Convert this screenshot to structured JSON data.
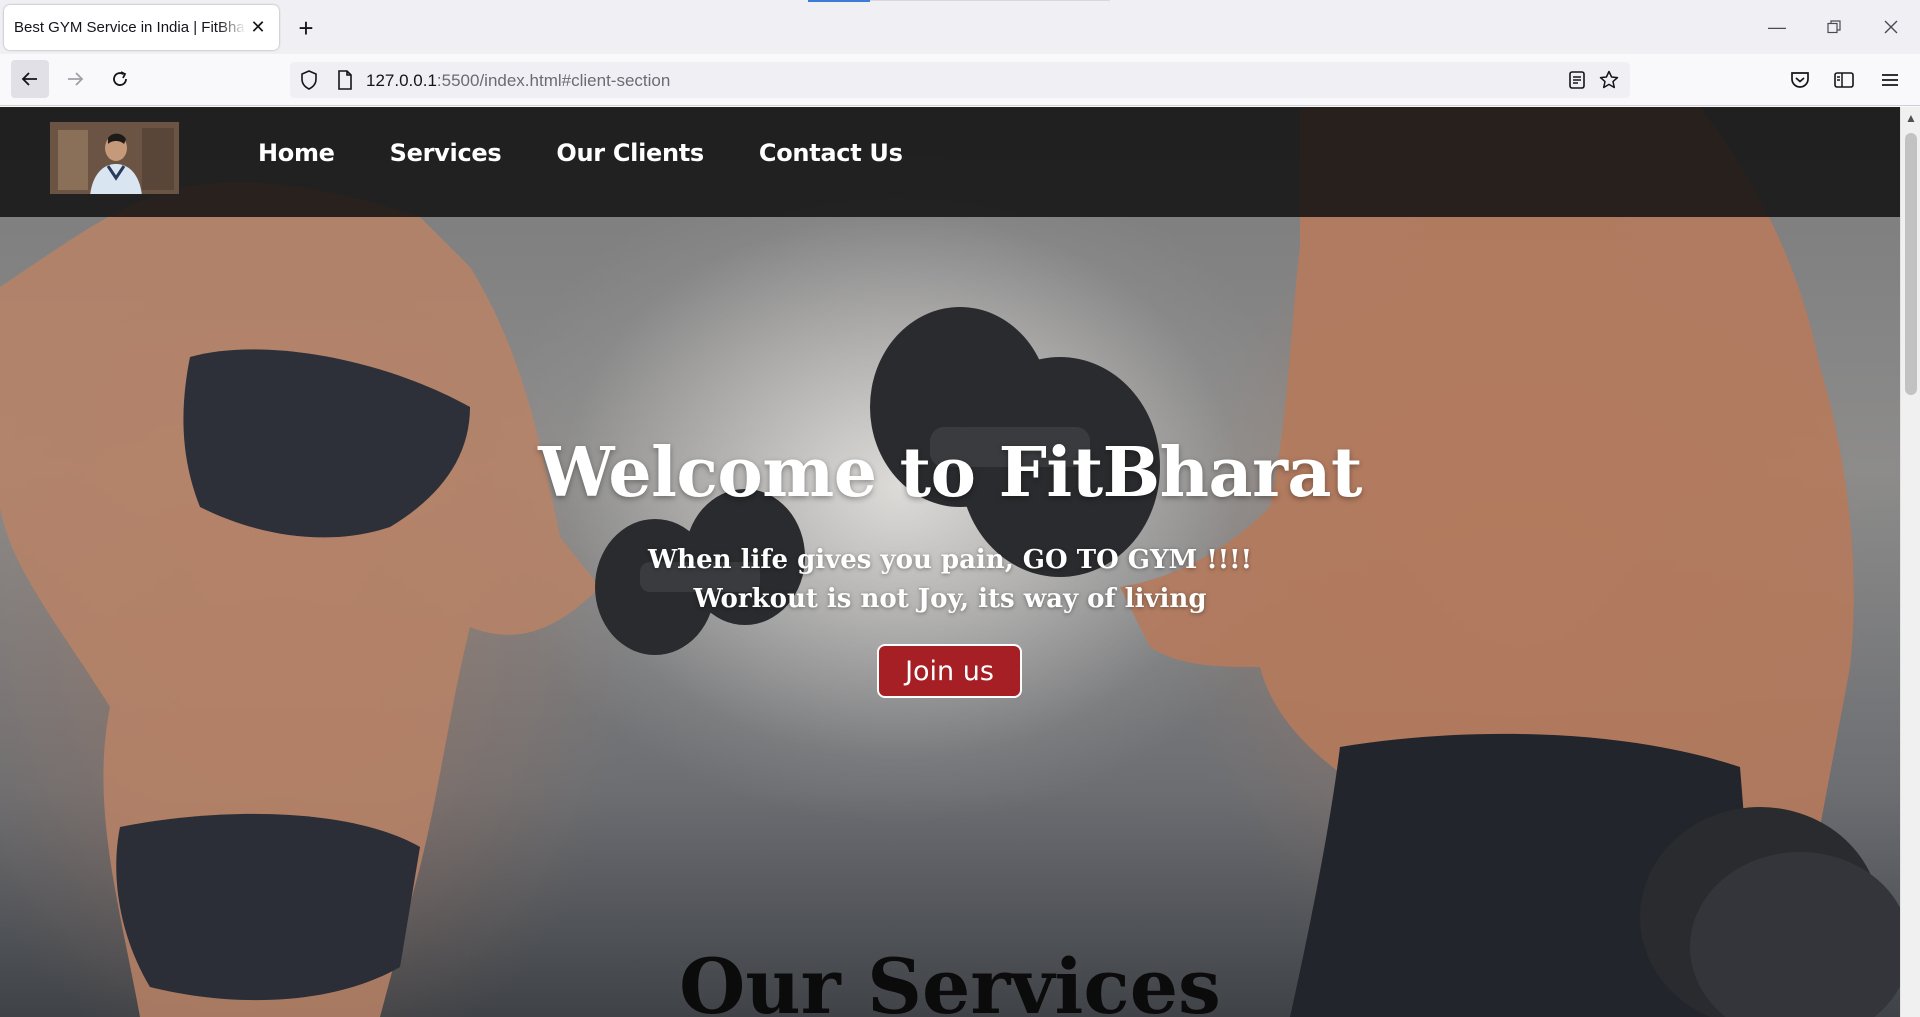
{
  "browser": {
    "tab_title": "Best GYM Service in India | FitBharat",
    "url_host": "127.0.0.1",
    "url_rest": ":5500/index.html#client-section"
  },
  "site": {
    "nav": [
      "Home",
      "Services",
      "Our Clients",
      "Contact Us"
    ],
    "hero_title": "Welcome to FitBharat",
    "hero_line1": "When life gives you pain, GO TO GYM !!!!",
    "hero_line2": "Workout is not Joy, its way of living",
    "cta": "Join us",
    "section_title": "Our Services"
  },
  "colors": {
    "cta_bg": "#a61f24",
    "header_bg": "#121212"
  }
}
